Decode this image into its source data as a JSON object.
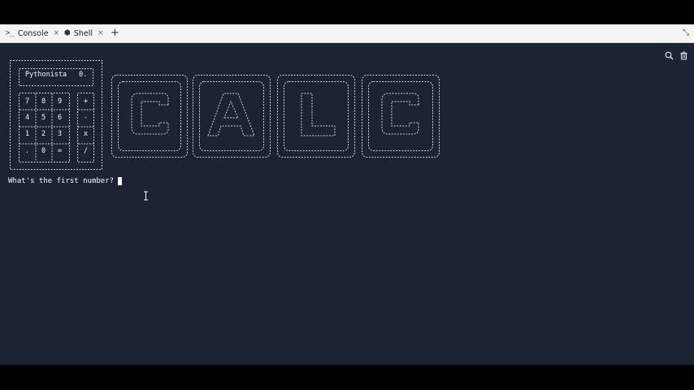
{
  "tabs": [
    {
      "label": "Console",
      "icon": "terminal-icon",
      "close": "×"
    },
    {
      "label": "Shell",
      "icon": "shell-icon",
      "close": "×"
    }
  ],
  "new_tab_label": "+",
  "colors": {
    "console_bg": "#1c2333",
    "text": "#f5f9fc",
    "tab_bar": "#f4f4f5"
  },
  "calculator": {
    "display_label": "Pythonista",
    "display_value": "0.",
    "keys": [
      [
        "7",
        "8",
        "9"
      ],
      [
        "4",
        "5",
        "6"
      ],
      [
        "1",
        "2",
        "3"
      ],
      [
        ".",
        "0",
        "="
      ]
    ],
    "ops": [
      "+",
      "-",
      "x",
      "/"
    ]
  },
  "banner_letters": [
    "C",
    "A",
    "L",
    "C"
  ],
  "prompt": {
    "text": "What's the first number?"
  }
}
